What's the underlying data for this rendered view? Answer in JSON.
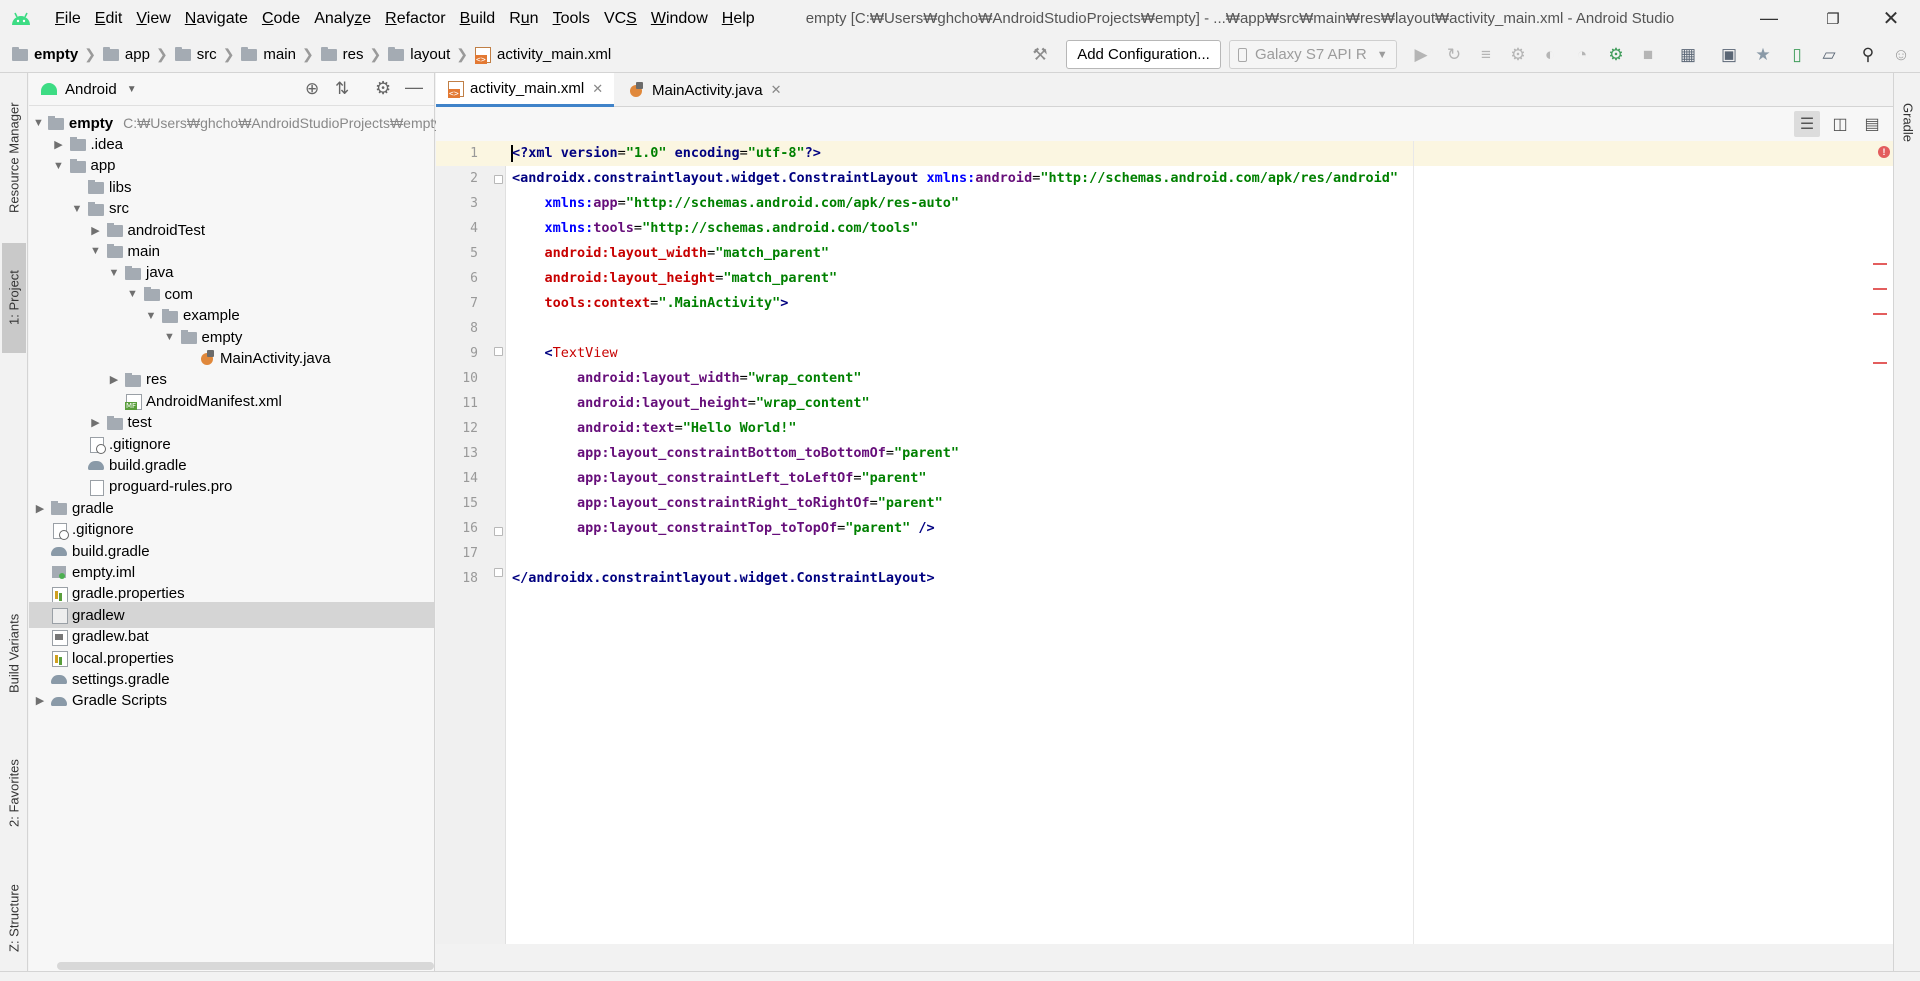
{
  "title_bar": {
    "menu": [
      {
        "pre": "",
        "mn": "F",
        "post": "ile"
      },
      {
        "pre": "",
        "mn": "E",
        "post": "dit"
      },
      {
        "pre": "",
        "mn": "V",
        "post": "iew"
      },
      {
        "pre": "",
        "mn": "N",
        "post": "avigate"
      },
      {
        "pre": "",
        "mn": "C",
        "post": "ode"
      },
      {
        "pre": "Analy",
        "mn": "z",
        "post": "e"
      },
      {
        "pre": "",
        "mn": "R",
        "post": "efactor"
      },
      {
        "pre": "",
        "mn": "B",
        "post": "uild"
      },
      {
        "pre": "R",
        "mn": "u",
        "post": "n"
      },
      {
        "pre": "",
        "mn": "T",
        "post": "ools"
      },
      {
        "pre": "VC",
        "mn": "S",
        "post": ""
      },
      {
        "pre": "",
        "mn": "W",
        "post": "indow"
      },
      {
        "pre": "",
        "mn": "H",
        "post": "elp"
      }
    ],
    "window_title": "empty [C:₩Users₩ghcho₩AndroidStudioProjects₩empty] - ...₩app₩src₩main₩res₩layout₩activity_main.xml - Android Studio"
  },
  "breadcrumb": [
    "empty",
    "app",
    "src",
    "main",
    "res",
    "layout",
    "activity_main.xml"
  ],
  "toolbar": {
    "add_configuration": "Add Configuration...",
    "device": "Galaxy S7 API R"
  },
  "left_strip": {
    "resource_manager": "Resource Manager",
    "project": "1: Project",
    "build_variants": "Build Variants",
    "favorites": "2: Favorites",
    "structure": "Z: Structure"
  },
  "right_strip": {
    "gradle": "Gradle"
  },
  "project_panel": {
    "view_mode": "Android",
    "tree": [
      {
        "label": "empty",
        "path": "C:₩Users₩ghcho₩AndroidStudioProjects₩empty",
        "icon": "project",
        "expanded": true
      },
      {
        "label": ".idea",
        "icon": "folder",
        "expanded": false
      },
      {
        "label": "app",
        "icon": "folder",
        "expanded": true
      },
      {
        "label": "libs",
        "icon": "folder"
      },
      {
        "label": "src",
        "icon": "folder",
        "expanded": true
      },
      {
        "label": "androidTest",
        "icon": "folder",
        "expanded": false
      },
      {
        "label": "main",
        "icon": "folder",
        "expanded": true
      },
      {
        "label": "java",
        "icon": "folder",
        "expanded": true
      },
      {
        "label": "com",
        "icon": "folder",
        "expanded": true
      },
      {
        "label": "example",
        "icon": "folder",
        "expanded": true
      },
      {
        "label": "empty",
        "icon": "folder",
        "expanded": true
      },
      {
        "label": "MainActivity.java",
        "icon": "java"
      },
      {
        "label": "res",
        "icon": "folder",
        "expanded": false
      },
      {
        "label": "AndroidManifest.xml",
        "icon": "manifest"
      },
      {
        "label": "test",
        "icon": "folder",
        "expanded": false
      },
      {
        "label": ".gitignore",
        "icon": "gitignore"
      },
      {
        "label": "build.gradle",
        "icon": "gradle"
      },
      {
        "label": "proguard-rules.pro",
        "icon": "file"
      },
      {
        "label": "gradle",
        "icon": "folder",
        "expanded": false
      },
      {
        "label": ".gitignore",
        "icon": "gitignore"
      },
      {
        "label": "build.gradle",
        "icon": "gradle"
      },
      {
        "label": "empty.iml",
        "icon": "iml"
      },
      {
        "label": "gradle.properties",
        "icon": "properties"
      },
      {
        "label": "gradlew",
        "icon": "exec",
        "selected": true
      },
      {
        "label": "gradlew.bat",
        "icon": "bat"
      },
      {
        "label": "local.properties",
        "icon": "properties"
      },
      {
        "label": "settings.gradle",
        "icon": "gradle"
      },
      {
        "label": "Gradle Scripts",
        "icon": "gradle-scripts",
        "expanded": false
      }
    ]
  },
  "editor": {
    "tabs": [
      {
        "label": "activity_main.xml",
        "active": true
      },
      {
        "label": "MainActivity.java",
        "active": false
      }
    ],
    "line_numbers": [
      "1",
      "2",
      "3",
      "4",
      "5",
      "6",
      "7",
      "8",
      "9",
      "10",
      "11",
      "12",
      "13",
      "14",
      "15",
      "16",
      "17",
      "18"
    ],
    "code": {
      "l1": {
        "a": "<?",
        "b": "xml version",
        "c": "=",
        "d": "\"1.0\"",
        "e": " encoding",
        "f": "=",
        "g": "\"utf-8\"",
        "h": "?>"
      },
      "l2": {
        "a": "<androidx.constraintlayout.widget.ConstraintLayout ",
        "b": "xmlns:",
        "c": "android",
        "d": "=",
        "e": "\"http://schemas.android.com/apk/res/android\""
      },
      "l3": {
        "a": "    xmlns:",
        "b": "app",
        "c": "=",
        "d": "\"http://schemas.android.com/apk/res-auto\""
      },
      "l4": {
        "a": "    xmlns:",
        "b": "tools",
        "c": "=",
        "d": "\"http://schemas.android.com/tools\""
      },
      "l5": {
        "a": "    android:layout_width",
        "b": "=",
        "c": "\"match_parent\""
      },
      "l6": {
        "a": "    android:layout_height",
        "b": "=",
        "c": "\"match_parent\""
      },
      "l7": {
        "a": "    tools:context",
        "b": "=",
        "c": "\".MainActivity\"",
        "d": ">"
      },
      "l9": {
        "a": "    <",
        "b": "TextView"
      },
      "l10": {
        "a": "        android:layout_width",
        "b": "=",
        "c": "\"wrap_content\""
      },
      "l11": {
        "a": "        android:layout_height",
        "b": "=",
        "c": "\"wrap_content\""
      },
      "l12": {
        "a": "        android:text",
        "b": "=",
        "c": "\"Hello World!\""
      },
      "l13": {
        "a": "        app:layout_constraintBottom_toBottomOf",
        "b": "=",
        "c": "\"parent\""
      },
      "l14": {
        "a": "        app:layout_constraintLeft_toLeftOf",
        "b": "=",
        "c": "\"parent\""
      },
      "l15": {
        "a": "        app:layout_constraintRight_toRightOf",
        "b": "=",
        "c": "\"parent\""
      },
      "l16": {
        "a": "        app:layout_constraintTop_toTopOf",
        "b": "=",
        "c": "\"parent\"",
        "d": " />"
      },
      "l18": {
        "a": "</androidx.constraintlayout.widget.ConstraintLayout>"
      }
    }
  },
  "colors": {
    "accent": "#4083c9",
    "android_green": "#3ddc84",
    "error_mark": "#e35d5d"
  }
}
